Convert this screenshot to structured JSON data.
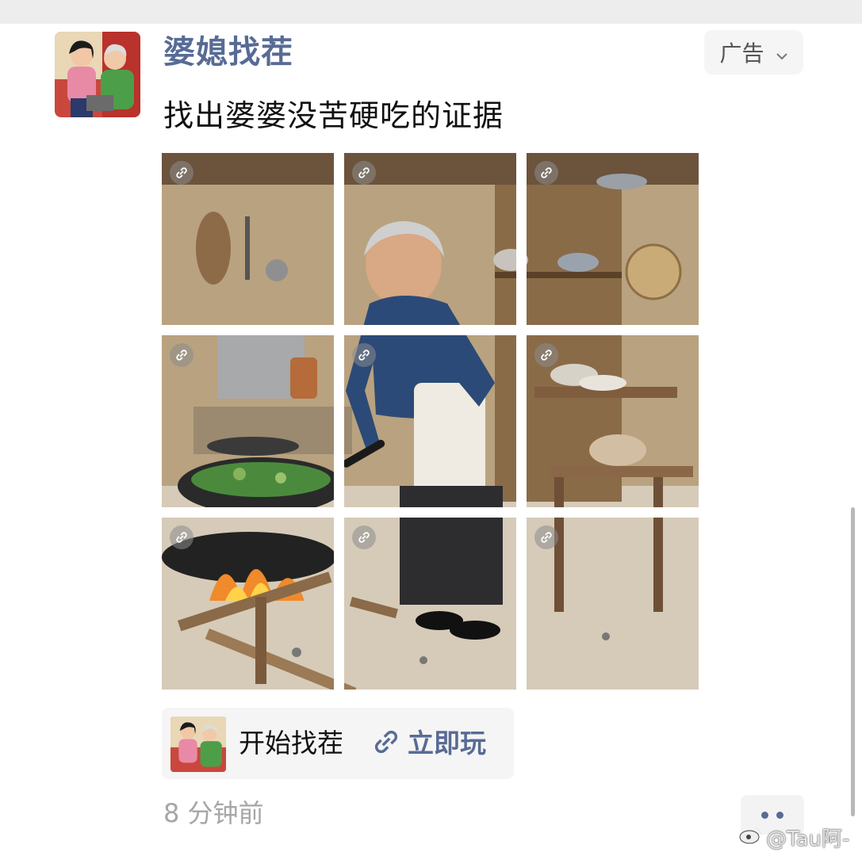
{
  "post": {
    "app_name": "婆媳找茬",
    "ad_label": "广告",
    "text": "找出婆婆没苦硬吃的证据",
    "timestamp": "8 分钟前"
  },
  "card": {
    "title": "开始找茬",
    "action_label": "立即玩"
  },
  "watermark": "@Tau阿-",
  "icons": {
    "ad_chevron": "chevron-down-icon",
    "link": "link-icon",
    "more": "more-dots-icon",
    "weibo": "weibo-icon"
  },
  "colors": {
    "link_blue": "#576b95",
    "card_bg": "#f5f5f5",
    "muted_text": "#a6a6a6"
  }
}
